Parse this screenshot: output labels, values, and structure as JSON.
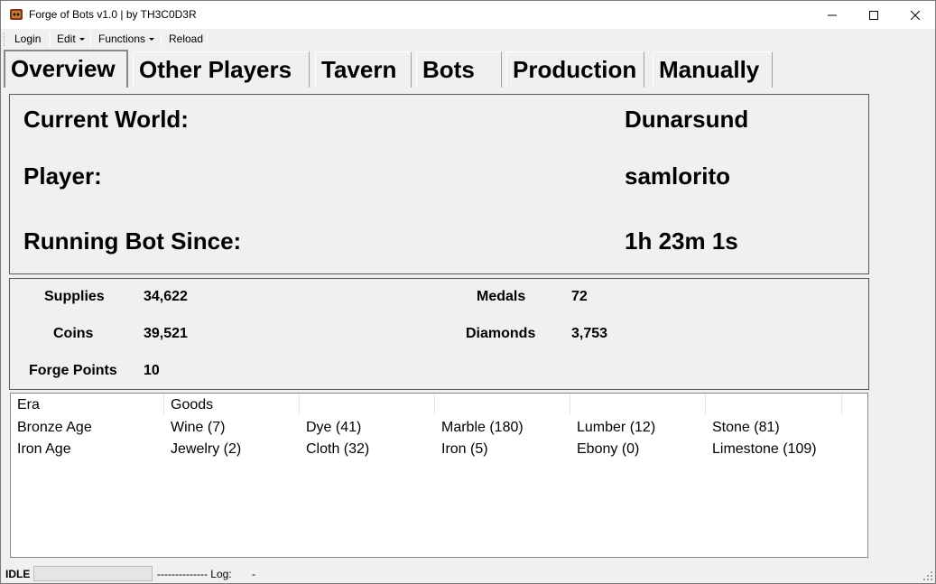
{
  "window": {
    "title": "Forge of Bots v1.0 | by TH3C0D3R",
    "icon": "forge-app-icon"
  },
  "menu": {
    "login": "Login",
    "edit": "Edit",
    "functions": "Functions",
    "reload": "Reload"
  },
  "tabs": [
    {
      "label": "Overview",
      "active": true
    },
    {
      "label": "Other Players"
    },
    {
      "label": "Tavern"
    },
    {
      "label": "Bots"
    },
    {
      "label": "Production"
    },
    {
      "label": "Manually"
    }
  ],
  "overview": {
    "world_label": "Current World:",
    "world_value": "Dunarsund",
    "player_label": "Player:",
    "player_value": "samlorito",
    "running_label": "Running Bot Since:",
    "running_value": "1h 23m 1s"
  },
  "stats": {
    "supplies_label": "Supplies",
    "supplies_value": "34,622",
    "coins_label": "Coins",
    "coins_value": "39,521",
    "fp_label": "Forge Points",
    "fp_value": "10",
    "medals_label": "Medals",
    "medals_value": "72",
    "diamonds_label": "Diamonds",
    "diamonds_value": "3,753"
  },
  "goods": {
    "headers": [
      "Era",
      "Goods",
      "",
      "",
      "",
      ""
    ],
    "rows": [
      [
        "Bronze Age",
        "Wine (7)",
        "Dye (41)",
        "Marble (180)",
        "Lumber (12)",
        "Stone (81)"
      ],
      [
        "Iron Age",
        "Jewelry (2)",
        "Cloth (32)",
        "Iron (5)",
        "Ebony (0)",
        "Limestone (109)"
      ]
    ]
  },
  "status": {
    "state": "IDLE",
    "log_prefix": "-------------- Log:",
    "log_value": "-"
  }
}
